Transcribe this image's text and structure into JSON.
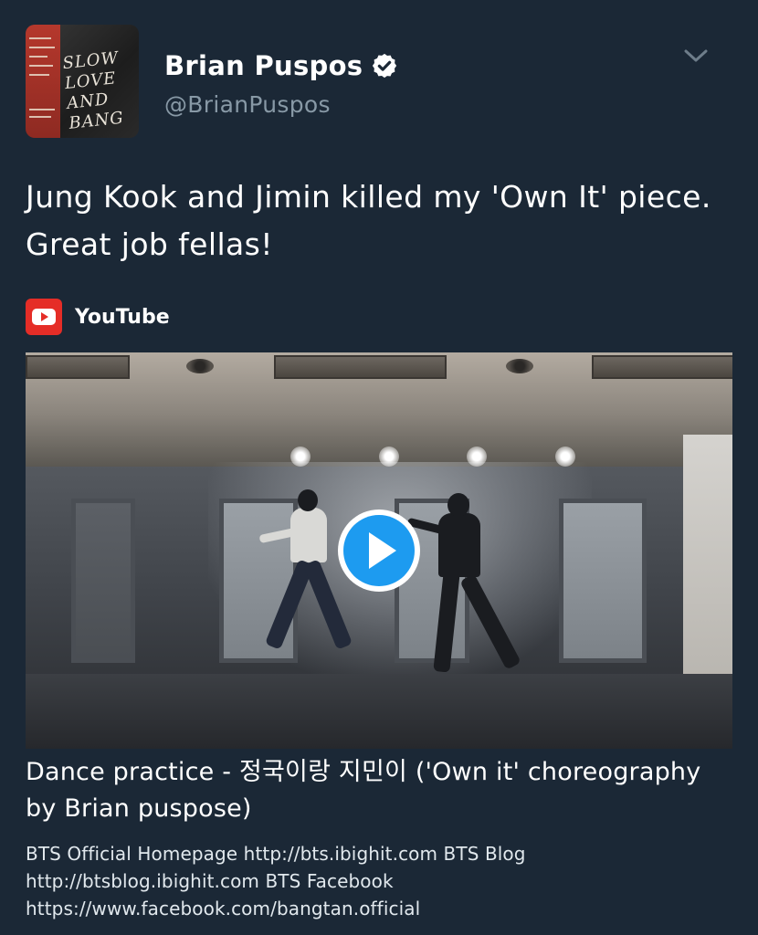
{
  "tweet": {
    "author_name": "Brian Puspos",
    "author_handle": "@BrianPuspos",
    "verified": true,
    "avatar": {
      "art_text": "SLOW LOVE AND BANG",
      "art_text_lines": [
        "SLOW",
        "LOVE",
        "AND",
        "BANG"
      ]
    },
    "text": "Jung Kook and Jimin killed my 'Own It' piece. Great job fellas!",
    "menu_icon": "chevron-down-icon"
  },
  "card": {
    "source_name": "YouTube",
    "source_icon": "youtube-logo-icon",
    "video_title": "Dance practice - 정국이랑 지민이 ('Own it' choreography by Brian puspose)",
    "video_description": "BTS Official Homepage http://bts.ibighit.com BTS Blog http://btsblog.ibighit.com BTS Facebook https://www.facebook.com/bangtan.official",
    "play_icon": "play-icon"
  },
  "colors": {
    "background": "#1b2836",
    "text_primary": "#ffffff",
    "text_secondary": "#8899a6",
    "accent": "#1d9bf0",
    "youtube_red": "#e52d27"
  }
}
